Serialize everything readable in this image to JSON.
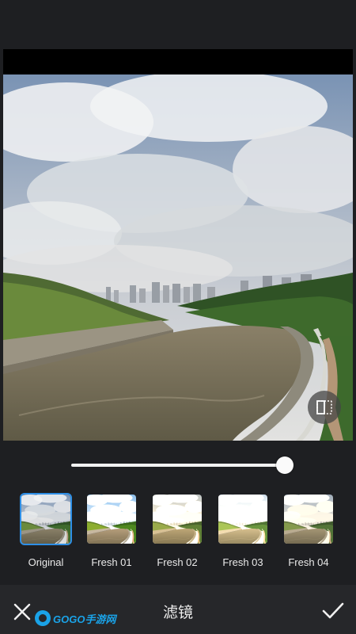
{
  "editor": {
    "title": "滤镜",
    "close_icon": "close-icon",
    "confirm_icon": "checkmark-icon",
    "compare_icon": "compare-icon"
  },
  "intensity_slider": {
    "value": 1.0
  },
  "filters": [
    {
      "label": "Original",
      "selected": true
    },
    {
      "label": "Fresh 01",
      "selected": false
    },
    {
      "label": "Fresh 02",
      "selected": false
    },
    {
      "label": "Fresh 03",
      "selected": false
    },
    {
      "label": "Fresh 04",
      "selected": false
    }
  ],
  "watermark": {
    "brand": "GOGO手游网"
  },
  "colors": {
    "accent": "#2e8fe6",
    "background": "#1e1f22",
    "bar": "#26272a"
  }
}
